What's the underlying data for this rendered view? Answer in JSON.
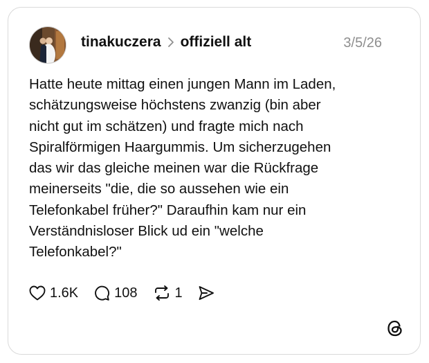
{
  "post": {
    "username": "tinakuczera",
    "topic": "offiziell alt",
    "date": "3/5/26",
    "text": "Hatte heute mittag einen jungen Mann im Laden,\nschätzungsweise höchstens zwanzig (bin aber\nnicht gut im schätzen) und fragte mich nach\nSpiralförmigen Haargummis. Um sicherzugehen\ndas wir das gleiche meinen war die Rückfrage\nmeinerseits \"die, die so aussehen wie ein\nTelefonkabel früher?\" Daraufhin kam nur ein\nVerständnisloser Blick ud ein \"welche\nTelefonkabel?\""
  },
  "actions": {
    "likes": "1.6K",
    "replies": "108",
    "reposts": "1"
  },
  "icons": {
    "like": "heart-icon",
    "reply": "comment-icon",
    "repost": "repost-icon",
    "share": "share-icon",
    "separator": "chevron-right-icon",
    "brand": "threads-logo-icon"
  },
  "colors": {
    "text": "#101010",
    "muted": "#8e8e8e",
    "border": "#d9d9d9"
  }
}
